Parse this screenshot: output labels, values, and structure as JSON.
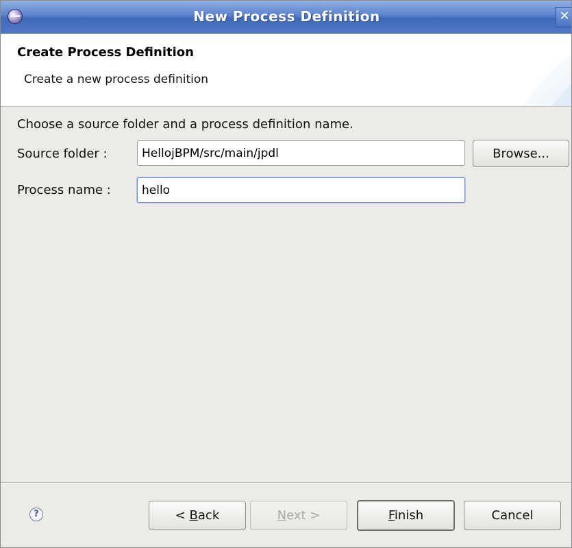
{
  "window": {
    "title": "New Process Definition",
    "close_label": "✕"
  },
  "banner": {
    "title": "Create Process Definition",
    "description": "Create a new process definition"
  },
  "form": {
    "instruction": "Choose a source folder and a process definition name.",
    "source_folder_label": "Source folder :",
    "source_folder_value": "HellojBPM/src/main/jpdl",
    "browse_label": "Browse...",
    "process_name_label": "Process name :",
    "process_name_value": "hello"
  },
  "footer": {
    "help_icon": "?",
    "back": {
      "prefix": "< ",
      "mnemonic": "B",
      "rest": "ack"
    },
    "next": {
      "mnemonic": "N",
      "rest": "ext >"
    },
    "finish": {
      "mnemonic": "F",
      "rest": "inish"
    },
    "cancel_label": "Cancel"
  },
  "icons": {
    "app": "eclipse-icon",
    "close": "close-icon",
    "help": "help-icon"
  },
  "colors": {
    "titlebar": "#4f77c4",
    "dialog_bg": "#edebe7",
    "focus_border": "#6a8fd3"
  }
}
